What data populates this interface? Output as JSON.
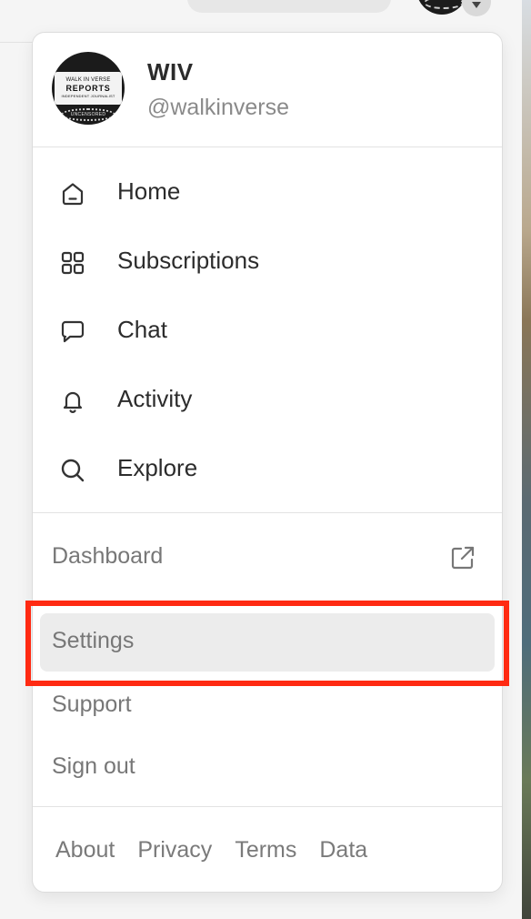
{
  "profile": {
    "name": "WIV",
    "handle": "@walkinverse",
    "avatar_text": {
      "line1": "WALK IN VERSE",
      "line2": "REPORTS",
      "line3": "INDEPENDENT JOURNALIST",
      "foot": "UNCENSORED"
    }
  },
  "nav": [
    {
      "label": "Home",
      "icon": "home-icon"
    },
    {
      "label": "Subscriptions",
      "icon": "grid-icon"
    },
    {
      "label": "Chat",
      "icon": "chat-bubble-icon"
    },
    {
      "label": "Activity",
      "icon": "bell-icon"
    },
    {
      "label": "Explore",
      "icon": "search-icon"
    }
  ],
  "secondary": {
    "dashboard": "Dashboard",
    "dashboard_icon": "external-link-icon",
    "settings": "Settings",
    "support": "Support",
    "sign_out": "Sign out"
  },
  "footer": [
    "About",
    "Privacy",
    "Terms",
    "Data"
  ],
  "highlight_color": "#ff2a12",
  "selected_bg": "#ececec"
}
